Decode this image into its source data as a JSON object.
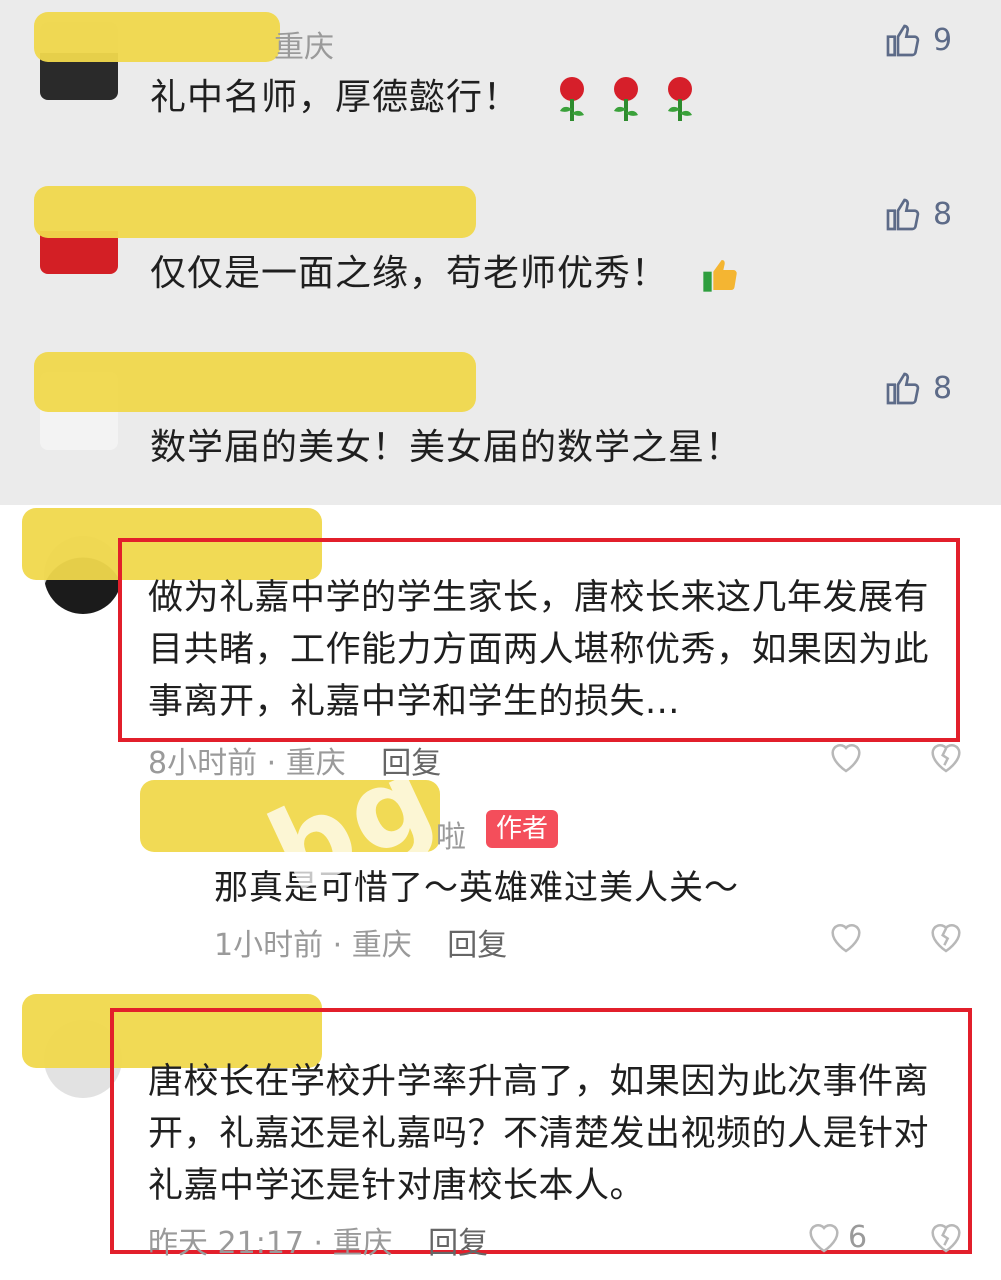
{
  "comments": [
    {
      "city": "重庆",
      "text": "礼中名师，厚德懿行！",
      "emoji": "rose-emoji",
      "likes": "9"
    },
    {
      "text": "仅仅是一面之缘，苟老师优秀！",
      "emoji": "thumbs-up-emoji",
      "likes": "8"
    },
    {
      "text": "数学届的美女！美女届的数学之星！",
      "likes": "8"
    }
  ],
  "comment4": {
    "lines": [
      "做为礼嘉中学的学生家长，唐校长来这几年发展有",
      "目共睹，工作能力方面两人堪称优秀，如果因为此",
      "事离开，礼嘉中学和学生的损失..."
    ],
    "time": "8小时前 · 重庆",
    "reply": "回复"
  },
  "reply": {
    "name_fragment": "啦",
    "badge": "作者",
    "text": "那真是可惜了～英雄难过美人关～",
    "time": "1小时前 · 重庆",
    "reply": "回复"
  },
  "comment5": {
    "lines": [
      "唐校长在学校升学率升高了，如果因为此次事件离",
      "开，礼嘉还是礼嘉吗？不清楚发出视频的人是针对",
      "礼嘉中学还是针对唐校长本人。"
    ],
    "time": "昨天 21:17 · 重庆",
    "reply": "回复",
    "likes": "6"
  },
  "watermark": "bg",
  "colors": {
    "highlight_box": "#e21f2b",
    "redaction": "#f0d84c",
    "badge": "#f44e5b"
  }
}
